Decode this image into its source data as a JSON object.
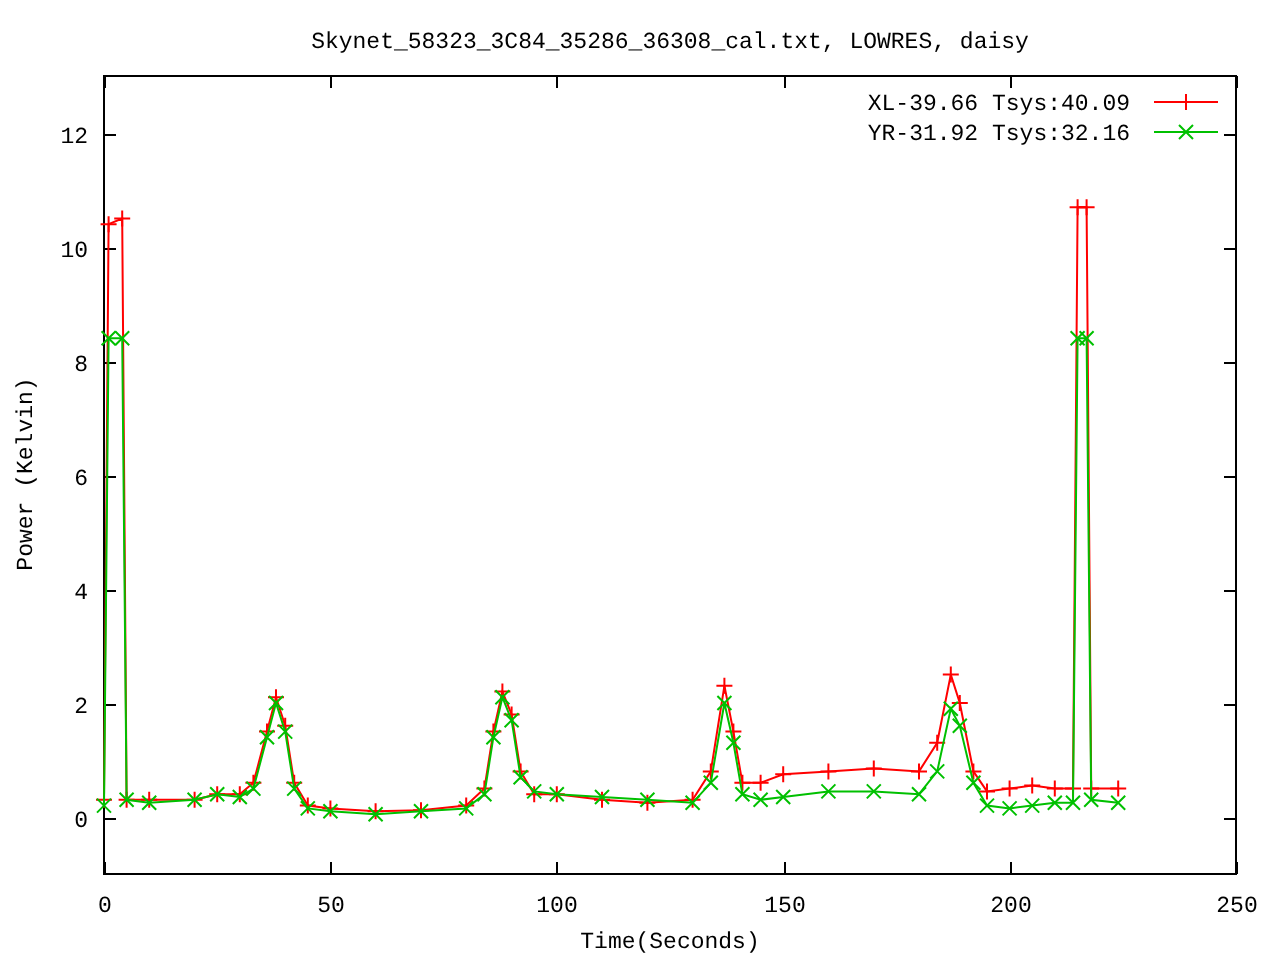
{
  "plot": {
    "chart_data": {
      "type": "line",
      "title": "Skynet_58323_3C84_35286_36308_cal.txt, LOWRES, daisy",
      "xlabel": "Time(Seconds)",
      "ylabel": "Power (Kelvin)",
      "x": [
        0,
        1,
        4,
        5,
        10,
        20,
        25,
        30,
        33,
        36,
        38,
        40,
        42,
        45,
        50,
        60,
        70,
        80,
        84,
        86,
        88,
        90,
        92,
        95,
        100,
        110,
        120,
        130,
        134,
        137,
        139,
        141,
        145,
        150,
        160,
        170,
        180,
        184,
        187,
        189,
        192,
        195,
        200,
        205,
        210,
        214,
        215,
        217,
        218,
        224
      ],
      "series": [
        {
          "name": "XL-39.66 Tsys:40.09",
          "color": "#ff0000",
          "values": [
            0.3,
            10.4,
            10.5,
            0.3,
            0.3,
            0.3,
            0.4,
            0.4,
            0.6,
            1.5,
            2.1,
            1.6,
            0.6,
            0.2,
            0.15,
            0.1,
            0.12,
            0.2,
            0.5,
            1.5,
            2.2,
            1.8,
            0.8,
            0.4,
            0.4,
            0.3,
            0.25,
            0.3,
            0.8,
            2.3,
            1.5,
            0.6,
            0.6,
            0.75,
            0.8,
            0.85,
            0.8,
            1.3,
            2.5,
            2.0,
            0.8,
            0.45,
            0.5,
            0.55,
            0.5,
            0.5,
            10.7,
            10.7,
            0.5,
            0.5
          ]
        },
        {
          "name": "YR-31.92 Tsys:32.16",
          "color": "#00c000",
          "values": [
            0.2,
            8.4,
            8.4,
            0.3,
            0.25,
            0.3,
            0.4,
            0.35,
            0.5,
            1.4,
            2.0,
            1.5,
            0.5,
            0.15,
            0.1,
            0.05,
            0.1,
            0.15,
            0.4,
            1.4,
            2.1,
            1.7,
            0.7,
            0.45,
            0.4,
            0.35,
            0.3,
            0.25,
            0.6,
            2.0,
            1.3,
            0.4,
            0.3,
            0.35,
            0.45,
            0.45,
            0.4,
            0.8,
            1.9,
            1.6,
            0.6,
            0.2,
            0.15,
            0.2,
            0.25,
            0.25,
            8.4,
            8.4,
            0.3,
            0.25
          ]
        }
      ],
      "legend": true,
      "xlim": [
        0,
        250
      ],
      "ylim": [
        -1,
        13
      ],
      "xticks": [
        0,
        50,
        100,
        150,
        200,
        250
      ],
      "yticks": [
        0,
        2,
        4,
        6,
        8,
        10,
        12
      ]
    }
  }
}
